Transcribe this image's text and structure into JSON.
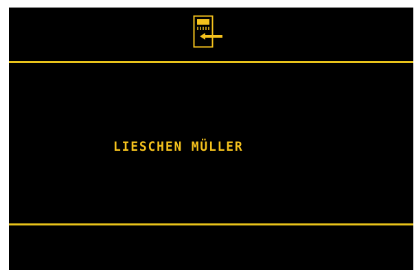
{
  "header": {
    "icon": "card-insert-icon"
  },
  "main": {
    "display_name": "LIESCHEN MÜLLER"
  },
  "colors": {
    "background": "#000000",
    "accent": "#f5c21d",
    "rule": "#e7c21a"
  }
}
